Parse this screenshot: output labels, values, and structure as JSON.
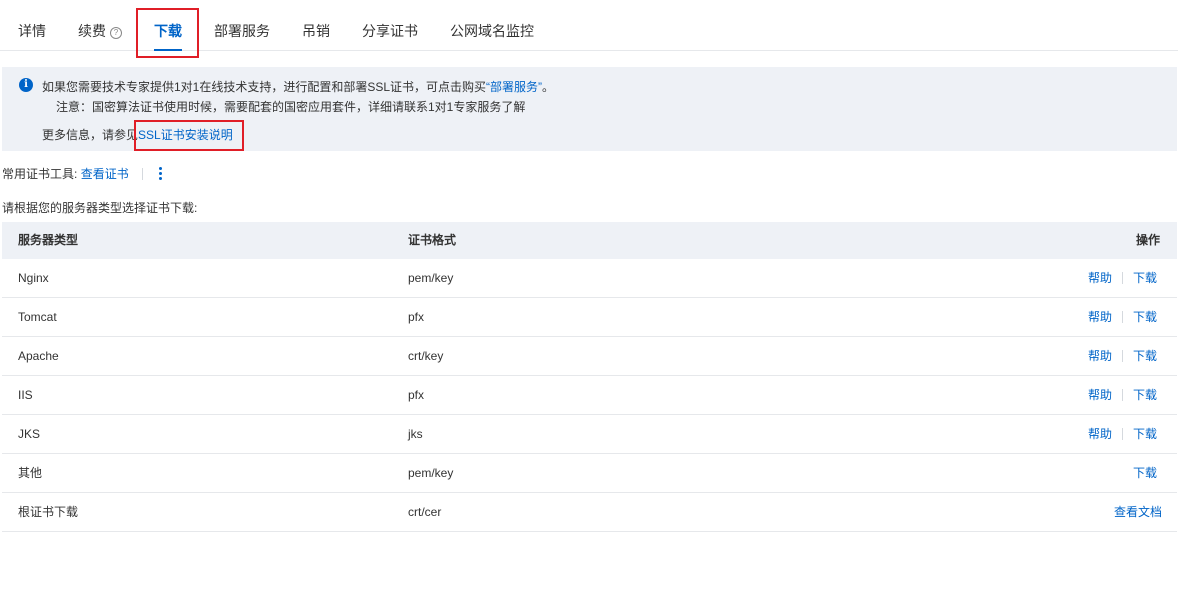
{
  "tabs": [
    {
      "label": "详情",
      "active": false
    },
    {
      "label": "续费",
      "active": false,
      "has_help": true
    },
    {
      "label": "下载",
      "active": true
    },
    {
      "label": "部署服务",
      "active": false
    },
    {
      "label": "吊销",
      "active": false
    },
    {
      "label": "分享证书",
      "active": false
    },
    {
      "label": "公网域名监控",
      "active": false
    }
  ],
  "help_glyph": "?",
  "notice": {
    "icon": "info-icon",
    "line1_prefix": "如果您需要技术专家提供1对1在线技术支持，进行配置和部署SSL证书，可点击购买",
    "line1_link": "“部署服务”",
    "line1_suffix": "。",
    "line2": "注意：国密算法证书使用时候，需要配套的国密应用套件，详细请联系1对1专家服务了解",
    "line3_prefix": "更多信息，请参见",
    "line3_link": "SSL证书安装说明"
  },
  "tools": {
    "label": "常用证书工具:",
    "link": "查看证书"
  },
  "subtitle": "请根据您的服务器类型选择证书下载:",
  "table": {
    "headers": {
      "server": "服务器类型",
      "format": "证书格式",
      "ops": "操作"
    },
    "rows": [
      {
        "server": "Nginx",
        "format": "pem/key",
        "help": "帮助",
        "download": "下载"
      },
      {
        "server": "Tomcat",
        "format": "pfx",
        "help": "帮助",
        "download": "下载"
      },
      {
        "server": "Apache",
        "format": "crt/key",
        "help": "帮助",
        "download": "下载"
      },
      {
        "server": "IIS",
        "format": "pfx",
        "help": "帮助",
        "download": "下载"
      },
      {
        "server": "JKS",
        "format": "jks",
        "help": "帮助",
        "download": "下载"
      },
      {
        "server": "其他",
        "format": "pem/key",
        "help": null,
        "download": "下载"
      },
      {
        "server": "根证书下载",
        "format": "crt/cer",
        "help": null,
        "download": null,
        "view_doc": "查看文档"
      }
    ]
  },
  "colors": {
    "accent": "#0064c8",
    "highlight": "#e01e27",
    "panel": "#eef1f6"
  }
}
